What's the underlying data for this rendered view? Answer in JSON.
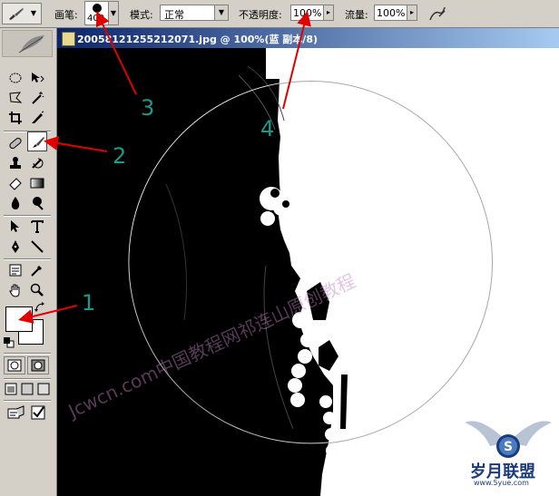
{
  "options_bar": {
    "brush_label": "画笔:",
    "brush_size": "400",
    "mode_label": "模式:",
    "mode_value": "正常",
    "opacity_label": "不透明度:",
    "opacity_value": "100%",
    "flow_label": "流量:",
    "flow_value": "100%"
  },
  "document": {
    "title": "20058121255212071.jpg @ 100%(蓝 副本/8)"
  },
  "watermark": {
    "text": "Jcwcn.com中国教程网祁连山原创教程"
  },
  "logo": {
    "text": "岁月联盟",
    "url_text": "www.5yue.com"
  },
  "callouts": [
    "1",
    "2",
    "3",
    "4"
  ],
  "colors": {
    "callout_number": "#1a9a8a",
    "arrow": "#e00000",
    "title_bar_start": "#0a246a",
    "title_bar_end": "#a6caf0"
  }
}
